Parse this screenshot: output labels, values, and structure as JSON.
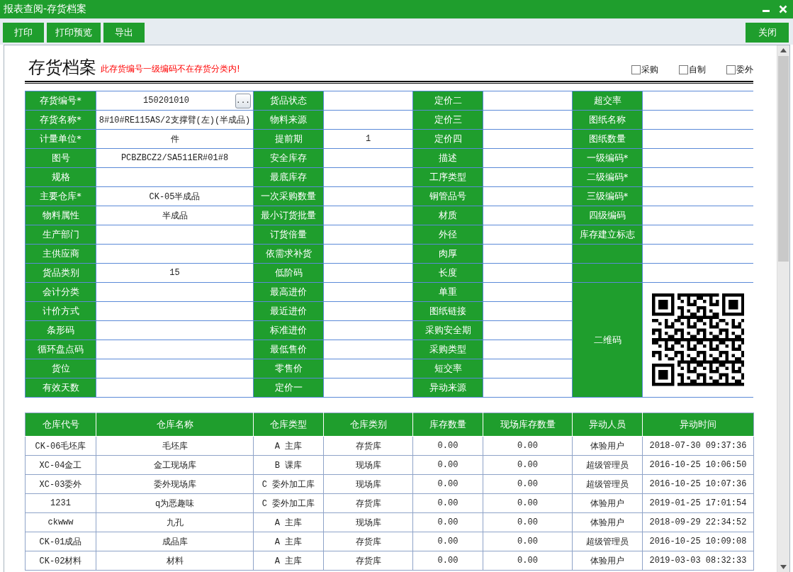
{
  "window": {
    "title": "报表查阅-存货档案"
  },
  "toolbar": {
    "buttons": [
      "打印",
      "打印预览",
      "导出"
    ],
    "close_button": "关闭"
  },
  "header": {
    "title": "存货档案",
    "warning": "此存货编号一级编码不在存货分类内!",
    "checkboxes": [
      {
        "label": "采购",
        "checked": false
      },
      {
        "label": "自制",
        "checked": false
      },
      {
        "label": "委外",
        "checked": false
      }
    ]
  },
  "form": {
    "columns": [
      [
        {
          "kind": "field",
          "label": "存货编号*",
          "value": "150201010",
          "button": "..."
        },
        {
          "kind": "field",
          "label": "存货名称*",
          "value": "8#10#RE115AS/2支撑臂(左)(半成品)"
        },
        {
          "kind": "field",
          "label": "计量单位*",
          "value": "件"
        },
        {
          "kind": "field",
          "label": "图号",
          "value": "PCBZBCZ2/SA511ER#01#8"
        },
        {
          "kind": "field",
          "label": "规格"
        },
        {
          "kind": "field",
          "label": "主要仓库*",
          "value": "CK-05半成品"
        },
        {
          "kind": "field",
          "label": "物料属性",
          "value": "半成品"
        },
        {
          "kind": "field",
          "label": "生产部门"
        },
        {
          "kind": "field",
          "label": "主供应商"
        },
        {
          "kind": "field",
          "label": "货品类别",
          "value": "15"
        },
        {
          "kind": "field",
          "label": "会计分类"
        },
        {
          "kind": "field",
          "label": "计价方式"
        },
        {
          "kind": "field",
          "label": "条形码"
        },
        {
          "kind": "field",
          "label": "循环盘点码"
        },
        {
          "kind": "field",
          "label": "货位"
        },
        {
          "kind": "field",
          "label": "有效天数"
        }
      ],
      [
        {
          "kind": "field",
          "label": "货品状态"
        },
        {
          "kind": "field",
          "label": "物料来源"
        },
        {
          "kind": "field",
          "label": "提前期",
          "value": "1"
        },
        {
          "kind": "field",
          "label": "安全库存"
        },
        {
          "kind": "field",
          "label": "最底库存"
        },
        {
          "kind": "field",
          "label": "一次采购数量"
        },
        {
          "kind": "field",
          "label": "最小订货批量"
        },
        {
          "kind": "field",
          "label": "订货倍量"
        },
        {
          "kind": "field",
          "label": "依需求补货"
        },
        {
          "kind": "field",
          "label": "低阶码"
        },
        {
          "kind": "field",
          "label": "最高进价"
        },
        {
          "kind": "field",
          "label": "最近进价"
        },
        {
          "kind": "field",
          "label": "标准进价"
        },
        {
          "kind": "field",
          "label": "最低售价"
        },
        {
          "kind": "field",
          "label": "零售价"
        },
        {
          "kind": "field",
          "label": "定价一"
        }
      ],
      [
        {
          "kind": "field",
          "label": "定价二"
        },
        {
          "kind": "field",
          "label": "定价三"
        },
        {
          "kind": "field",
          "label": "定价四"
        },
        {
          "kind": "field",
          "label": "描述"
        },
        {
          "kind": "field",
          "label": "工序类型"
        },
        {
          "kind": "field",
          "label": "铜管品号"
        },
        {
          "kind": "field",
          "label": "材质"
        },
        {
          "kind": "field",
          "label": "外径"
        },
        {
          "kind": "field",
          "label": "肉厚"
        },
        {
          "kind": "field",
          "label": "长度"
        },
        {
          "kind": "field",
          "label": "单重"
        },
        {
          "kind": "field",
          "label": "图纸链接"
        },
        {
          "kind": "field",
          "label": "采购安全期"
        },
        {
          "kind": "field",
          "label": "采购类型"
        },
        {
          "kind": "field",
          "label": "短交率"
        },
        {
          "kind": "field",
          "label": "异动来源"
        }
      ],
      [
        {
          "kind": "field",
          "label": "超交率"
        },
        {
          "kind": "field",
          "label": "图纸名称"
        },
        {
          "kind": "field",
          "label": "图纸数量"
        },
        {
          "kind": "field",
          "label": "一级编码*"
        },
        {
          "kind": "field",
          "label": "二级编码*"
        },
        {
          "kind": "field",
          "label": "三级编码*"
        },
        {
          "kind": "field",
          "label": "四级编码"
        },
        {
          "kind": "field",
          "label": "库存建立标志"
        },
        {
          "kind": "blank"
        },
        {
          "kind": "blank"
        },
        {
          "kind": "qr",
          "label": "二维码"
        }
      ]
    ]
  },
  "stock_table": {
    "columns": [
      "仓库代号",
      "仓库名称",
      "仓库类型",
      "仓库类别",
      "库存数量",
      "现场库存数量",
      "异动人员",
      "异动时间"
    ],
    "rows": [
      [
        "CK-06毛坯库",
        "毛坯库",
        "A 主库",
        "存货库",
        "0.00",
        "0.00",
        "体验用户",
        "2018-07-30 09:37:36"
      ],
      [
        "XC-04金工",
        "金工现场库",
        "B 课库",
        "现场库",
        "0.00",
        "0.00",
        "超级管理员",
        "2016-10-25 10:06:50"
      ],
      [
        "XC-03委外",
        "委外现场库",
        "C 委外加工库",
        "现场库",
        "0.00",
        "0.00",
        "超级管理员",
        "2016-10-25 10:07:36"
      ],
      [
        "1231",
        "q为恶趣味",
        "C 委外加工库",
        "存货库",
        "0.00",
        "0.00",
        "体验用户",
        "2019-01-25 17:01:54"
      ],
      [
        "ckwww",
        "九孔",
        "A 主库",
        "现场库",
        "0.00",
        "0.00",
        "体验用户",
        "2018-09-29 22:34:52"
      ],
      [
        "CK-01成品",
        "成品库",
        "A 主库",
        "存货库",
        "0.00",
        "0.00",
        "超级管理员",
        "2016-10-25 10:09:08"
      ],
      [
        "CK-02材料",
        "材料",
        "A 主库",
        "存货库",
        "0.00",
        "0.00",
        "体验用户",
        "2019-03-03 08:32:33"
      ]
    ]
  }
}
